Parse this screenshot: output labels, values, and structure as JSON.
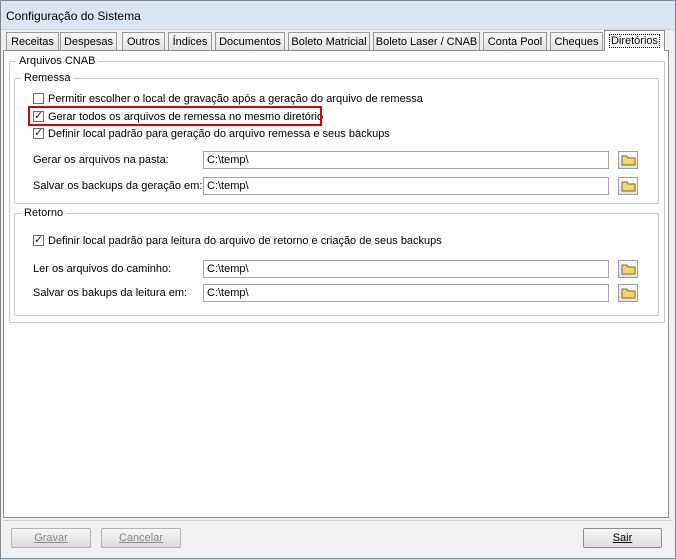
{
  "window": {
    "title": "Configuração do Sistema"
  },
  "tabs": [
    {
      "label": "Receitas"
    },
    {
      "label": "Despesas"
    },
    {
      "label": "Outros"
    },
    {
      "label": "Índices"
    },
    {
      "label": "Documentos"
    },
    {
      "label": "Boleto Matricial"
    },
    {
      "label": "Boleto Laser / CNAB"
    },
    {
      "label": "Conta Pool"
    },
    {
      "label": "Cheques"
    },
    {
      "label": "Diretórios",
      "active": true
    }
  ],
  "cnab": {
    "label": "Arquivos CNAB",
    "remessa": {
      "label": "Remessa",
      "opt1": {
        "label": "Permitir escolher o local de gravação após a geração do arquivo de remessa",
        "checked": false
      },
      "opt2": {
        "label": "Gerar todos os arquivos de remessa no mesmo diretório",
        "checked": true
      },
      "opt3": {
        "label": "Definir local padrão para geração do arquivo remessa e seus backups",
        "checked": true
      },
      "gerar_label": "Gerar os arquivos na pasta:",
      "gerar_value": "C:\\temp\\",
      "salvar_label": "Salvar os backups da geração em:",
      "salvar_value": "C:\\temp\\"
    },
    "retorno": {
      "label": "Retorno",
      "opt1": {
        "label": "Definir local padrão para leitura do arquivo de retorno e criação de seus backups",
        "checked": true
      },
      "ler_label": "Ler os arquivos do caminho:",
      "ler_value": "C:\\temp\\",
      "salvar_label": "Salvar os bakups da leitura em:",
      "salvar_value": "C:\\temp\\"
    }
  },
  "buttons": {
    "gravar": {
      "label": "Gravar",
      "enabled": false
    },
    "cancelar": {
      "label": "Cancelar",
      "enabled": false
    },
    "sair": {
      "label": "Sair",
      "enabled": true
    }
  },
  "icons": {
    "folder": "folder-icon",
    "check": "check-icon"
  },
  "colors": {
    "highlight": "#e00000",
    "folder": "#f5d66b"
  }
}
